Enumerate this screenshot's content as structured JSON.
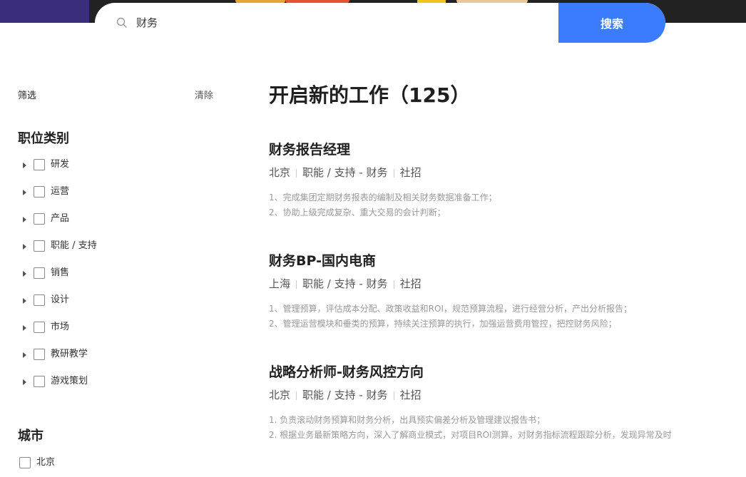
{
  "search": {
    "query": "财务",
    "button_label": "搜索"
  },
  "sidebar": {
    "filter_title": "筛选",
    "clear_label": "清除",
    "category_title": "职位类别",
    "categories": [
      {
        "label": "研发"
      },
      {
        "label": "运营"
      },
      {
        "label": "产品"
      },
      {
        "label": "职能 / 支持"
      },
      {
        "label": "销售"
      },
      {
        "label": "设计"
      },
      {
        "label": "市场"
      },
      {
        "label": "教研教学"
      },
      {
        "label": "游戏策划"
      }
    ],
    "city_title": "城市",
    "cities": [
      {
        "label": "北京"
      }
    ]
  },
  "main": {
    "title": "开启新的工作（125）",
    "jobs": [
      {
        "title": "财务报告经理",
        "city": "北京",
        "category": "职能 / 支持 - 财务",
        "type": "社招",
        "desc": [
          "1、完成集团定期财务报表的编制及相关财务数据准备工作；",
          "2、协助上级完成复杂、重大交易的会计判断；"
        ]
      },
      {
        "title": "财务BP-国内电商",
        "city": "上海",
        "category": "职能 / 支持 - 财务",
        "type": "社招",
        "desc": [
          "1、管理预算，评估成本分配、政策收益和ROI，规范预算流程，进行经营分析，产出分析报告；",
          "2、管理运营模块和垂类的预算，持续关注预算的执行，加强运营费用管控，把控财务风险；"
        ]
      },
      {
        "title": "战略分析师-财务风控方向",
        "city": "北京",
        "category": "职能 / 支持 - 财务",
        "type": "社招",
        "desc": [
          "1. 负责滚动财务预算和财务分析，出具预实偏差分析及管理建议报告书；",
          "2. 根据业务最新策略方向，深入了解商业模式，对项目ROI测算，对财务指标流程跟踪分析，发现异常及时"
        ]
      }
    ]
  }
}
